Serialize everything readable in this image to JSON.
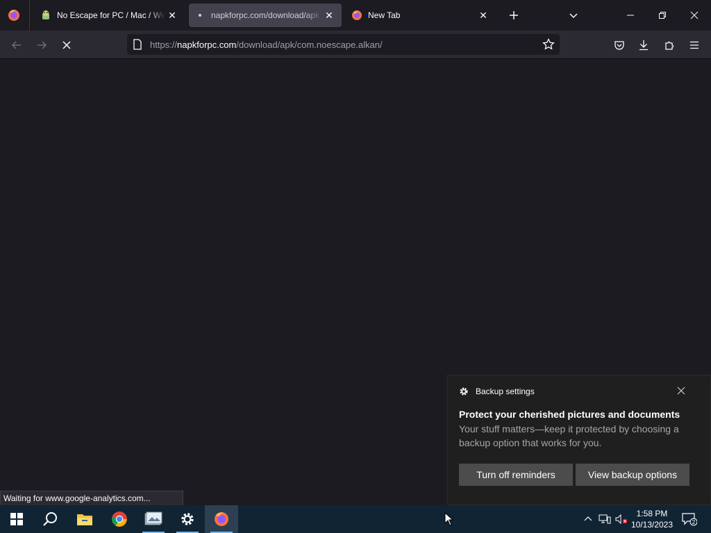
{
  "browser": {
    "tabs": [
      {
        "title": "No Escape for PC / Mac / Wind",
        "icon": "android-icon",
        "active": false,
        "loading": false
      },
      {
        "title": "napkforpc.com/download/apk",
        "icon": "loading-dot",
        "active": true,
        "loading": true
      },
      {
        "title": "New Tab",
        "icon": "firefox-icon",
        "active": false,
        "loading": false
      }
    ],
    "url": {
      "prefix": "https://",
      "host": "napkforpc.com",
      "path": "/download/apk/com.noescape.alkan/"
    },
    "status_text": "Waiting for www.google-analytics.com..."
  },
  "toast": {
    "header": "Backup settings",
    "title": "Protect your cherished pictures and documents",
    "body": "Your stuff matters—keep it protected by choosing a backup option that works for you.",
    "button_reminders": "Turn off reminders",
    "button_options": "View backup options"
  },
  "taskbar": {
    "apps": [
      "start-icon",
      "search-icon",
      "file-explorer-icon",
      "chrome-icon",
      "photos-icon",
      "settings-icon",
      "firefox-icon"
    ],
    "clock_time": "1:58 PM",
    "clock_date": "10/13/2023",
    "notification_count": "2"
  },
  "colors": {
    "taskbar_bg": "#102434",
    "browser_bg": "#1c1b22",
    "toolbar_bg": "#2b2a33",
    "toast_bg": "#1f1f1f",
    "toast_button_bg": "#4c4c4c"
  }
}
